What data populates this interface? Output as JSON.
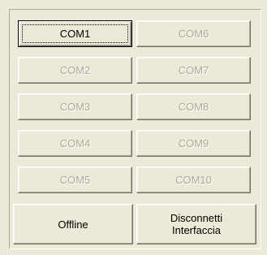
{
  "ports": {
    "left": [
      {
        "label": "COM1",
        "enabled": true
      },
      {
        "label": "COM2",
        "enabled": false
      },
      {
        "label": "COM3",
        "enabled": false
      },
      {
        "label": "COM4",
        "enabled": false
      },
      {
        "label": "COM5",
        "enabled": false
      }
    ],
    "right": [
      {
        "label": "COM6",
        "enabled": false
      },
      {
        "label": "COM7",
        "enabled": false
      },
      {
        "label": "COM8",
        "enabled": false
      },
      {
        "label": "COM9",
        "enabled": false
      },
      {
        "label": "COM10",
        "enabled": false
      }
    ]
  },
  "actions": {
    "offline_label": "Offline",
    "disconnect_label_line1": "Disconnetti",
    "disconnect_label_line2": "Interfaccia"
  },
  "colors": {
    "background": "#ece9d8",
    "disabled_text": "#aca899",
    "enabled_text": "#000000"
  }
}
